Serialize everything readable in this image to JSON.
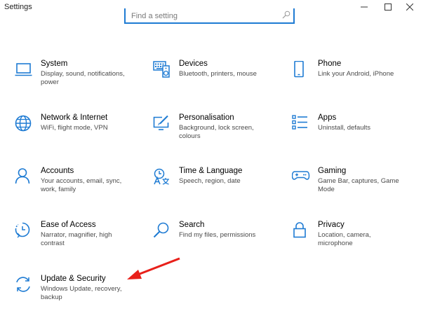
{
  "window": {
    "title": "Settings",
    "controls": [
      "minimize",
      "maximize",
      "close"
    ]
  },
  "search": {
    "placeholder": "Find a setting",
    "value": ""
  },
  "colors": {
    "accent": "#1e7bd3",
    "annotation": "#e8201a"
  },
  "settings": [
    {
      "icon": "laptop-icon",
      "name": "System",
      "desc": "Display, sound, notifications, power"
    },
    {
      "icon": "keyboard-speaker-icon",
      "name": "Devices",
      "desc": "Bluetooth, printers, mouse"
    },
    {
      "icon": "phone-icon",
      "name": "Phone",
      "desc": "Link your Android, iPhone"
    },
    {
      "icon": "globe-icon",
      "name": "Network & Internet",
      "desc": "WiFi, flight mode, VPN"
    },
    {
      "icon": "paint-screen-icon",
      "name": "Personalisation",
      "desc": "Background, lock screen, colours"
    },
    {
      "icon": "apps-list-icon",
      "name": "Apps",
      "desc": "Uninstall, defaults"
    },
    {
      "icon": "person-icon",
      "name": "Accounts",
      "desc": "Your accounts, email, sync, work, family"
    },
    {
      "icon": "time-language-icon",
      "name": "Time & Language",
      "desc": "Speech, region, date"
    },
    {
      "icon": "gamepad-icon",
      "name": "Gaming",
      "desc": "Game Bar, captures, Game Mode"
    },
    {
      "icon": "ease-of-access-icon",
      "name": "Ease of Access",
      "desc": "Narrator, magnifier, high contrast"
    },
    {
      "icon": "search-icon",
      "name": "Search",
      "desc": "Find my files, permissions"
    },
    {
      "icon": "lock-icon",
      "name": "Privacy",
      "desc": "Location, camera, microphone"
    },
    {
      "icon": "update-sync-icon",
      "name": "Update & Security",
      "desc": "Windows Update, recovery, backup"
    }
  ]
}
